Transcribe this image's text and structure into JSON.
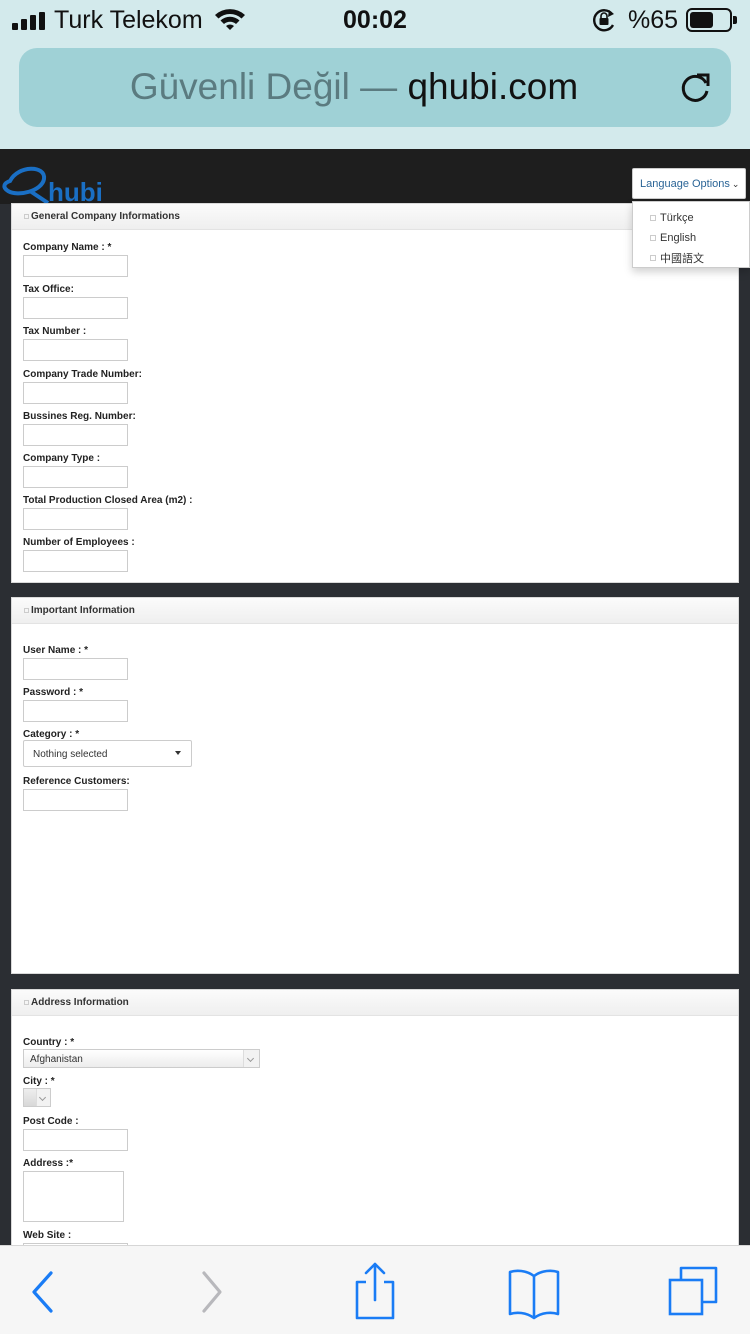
{
  "status_bar": {
    "carrier": "Turk Telekom",
    "time": "00:02",
    "battery_percent": "%65",
    "battery_level": 0.65
  },
  "url_bar": {
    "security_label": "Güvenli Değil —",
    "host": "qhubi.com"
  },
  "page": {
    "logo_text": "Qhubi",
    "language_button": "Language Options",
    "languages": [
      "Türkçe",
      "English",
      "中國語文"
    ],
    "general_panel": {
      "title": "General Company Informations",
      "fields": [
        "Company Name : *",
        "Tax Office:",
        "Tax Number :",
        "Company Trade Number:",
        "Bussines Reg. Number:",
        "Company Type :",
        "Total Production Closed Area (m2) :",
        "Number of Employees :"
      ]
    },
    "important_panel": {
      "title": "Important Information",
      "user_name_label": "User Name : *",
      "password_label": "Password : *",
      "category_label": "Category : *",
      "category_value": "Nothing selected",
      "reference_label": "Reference Customers:"
    },
    "address_panel": {
      "title": "Address Information",
      "country_label": "Country : *",
      "country_value": "Afghanistan",
      "city_label": "City : *",
      "post_code_label": "Post Code :",
      "address_label": "Address :*",
      "web_site_label": "Web Site :"
    }
  },
  "toolbar": {
    "icons": [
      "back-icon",
      "forward-icon",
      "share-icon",
      "bookmarks-icon",
      "tabs-icon"
    ],
    "accent": "#1a7cf5"
  }
}
